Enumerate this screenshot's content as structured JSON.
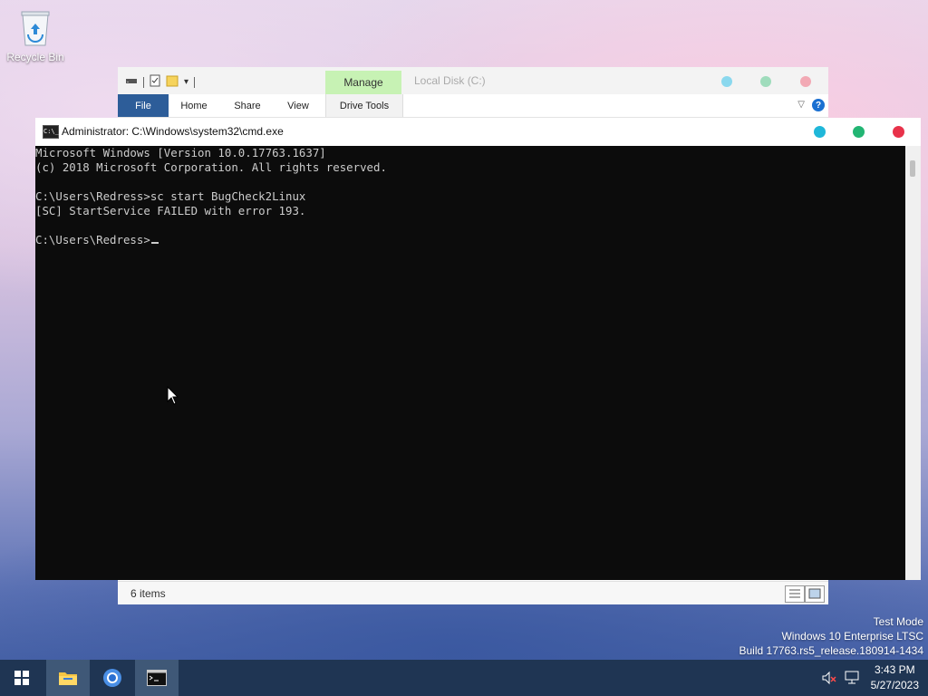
{
  "desktop": {
    "recycle_bin_label": "Recycle Bin"
  },
  "explorer": {
    "manage_tab": "Manage",
    "title": "Local Disk (C:)",
    "ribbon_tabs": {
      "file": "File",
      "home": "Home",
      "share": "Share",
      "view": "View",
      "drive_tools": "Drive Tools"
    },
    "help_glyph": "?",
    "status_count": "6 items"
  },
  "cmd": {
    "title": "Administrator: C:\\Windows\\system32\\cmd.exe",
    "icon_text": "C:\\_",
    "lines": [
      "Microsoft Windows [Version 10.0.17763.1637]",
      "(c) 2018 Microsoft Corporation. All rights reserved.",
      "",
      "C:\\Users\\Redress>sc start BugCheck2Linux",
      "[SC] StartService FAILED with error 193.",
      "",
      "C:\\Users\\Redress>"
    ]
  },
  "watermark": {
    "line1": "Test Mode",
    "line2": "Windows 10 Enterprise LTSC",
    "line3": "Build 17763.rs5_release.180914-1434"
  },
  "taskbar": {
    "clock_time": "3:43 PM",
    "clock_date": "5/27/2023",
    "icons": [
      "start-icon",
      "file-explorer-icon",
      "chrome-icon",
      "cmd-icon",
      "volume-muted-icon",
      "network-icon"
    ]
  },
  "colors": {
    "accent_file_tab": "#2d5d99",
    "manage_tab": "#c7f2b4",
    "console_bg": "#0c0c0c",
    "console_text": "#cccccc",
    "taskbar": "#1f3553",
    "dot_cyan": "#1fb7d9",
    "dot_green": "#22b573",
    "dot_red": "#e8324a"
  }
}
